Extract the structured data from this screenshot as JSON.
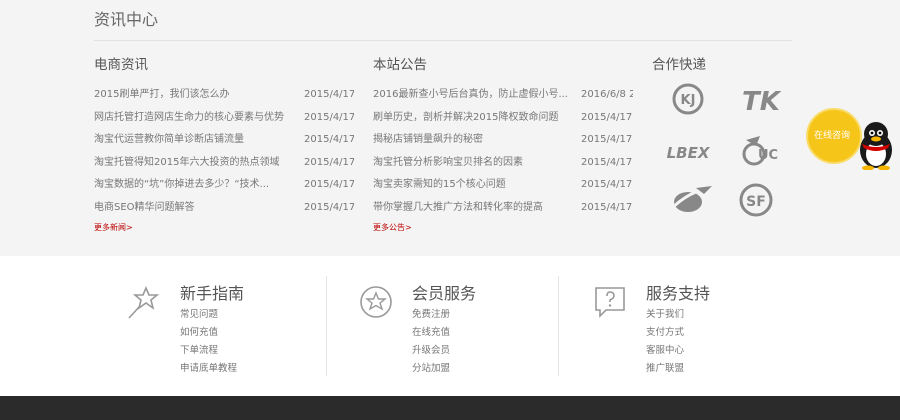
{
  "section_title": "资讯中心",
  "news": {
    "title": "电商资讯",
    "items": [
      {
        "title": "2015刷单严打，我们该怎么办",
        "date": "2015/4/17"
      },
      {
        "title": "网店托管打造网店生命力的核心要素与优势",
        "date": "2015/4/17"
      },
      {
        "title": "淘宝代运营教你简单诊断店铺流量",
        "date": "2015/4/17"
      },
      {
        "title": "淘宝托管得知2015年六大投资的热点领域",
        "date": "2015/4/17"
      },
      {
        "title": "淘宝数据的“坑”你掉进去多少？“技术...",
        "date": "2015/4/17"
      },
      {
        "title": "电商SEO精华问题解答",
        "date": "2015/4/17"
      }
    ],
    "more": "更多新闻>"
  },
  "notice": {
    "title": "本站公告",
    "items": [
      {
        "title": "2016最新查小号后台真伪，防止虚假小号...",
        "date": "2016/6/8 2"
      },
      {
        "title": "刷单历史，剖析并解决2015降权致命问题",
        "date": "2015/4/17"
      },
      {
        "title": "揭秘店铺销量飙升的秘密",
        "date": "2015/4/17"
      },
      {
        "title": "淘宝托管分析影响宝贝排名的因素",
        "date": "2015/4/17"
      },
      {
        "title": "淘宝卖家需知的15个核心问题",
        "date": "2015/4/17"
      },
      {
        "title": "带你掌握几大推广方法和转化率的提高",
        "date": "2015/4/17"
      }
    ],
    "more": "更多公告>"
  },
  "partners": {
    "title": "合作快递",
    "logos": [
      {
        "name": "kj-express-logo",
        "text": "KJ"
      },
      {
        "name": "tk-express-logo",
        "text": "TK"
      },
      {
        "name": "lbex-express-logo",
        "text": "LBEX"
      },
      {
        "name": "uc-express-logo",
        "text": "UC"
      },
      {
        "name": "orbit-express-logo",
        "text": ""
      },
      {
        "name": "sf-express-logo",
        "text": "SF"
      }
    ]
  },
  "qq_widget": {
    "label": "在线咨询"
  },
  "guide": [
    {
      "title": "新手指南",
      "icon": "star-wand-icon",
      "links": [
        "常见问题",
        "如何充值",
        "下单流程",
        "申请底单教程"
      ]
    },
    {
      "title": "会员服务",
      "icon": "star-badge-icon",
      "links": [
        "免费注册",
        "在线充值",
        "升级会员",
        "分站加盟"
      ]
    },
    {
      "title": "服务支持",
      "icon": "help-chat-icon",
      "links": [
        "关于我们",
        "支付方式",
        "客服中心",
        "推广联盟"
      ]
    }
  ],
  "colors": {
    "more_link": "#bb0000",
    "footer": "#2b2b2b",
    "qq_bubble": "#f6c51a"
  }
}
